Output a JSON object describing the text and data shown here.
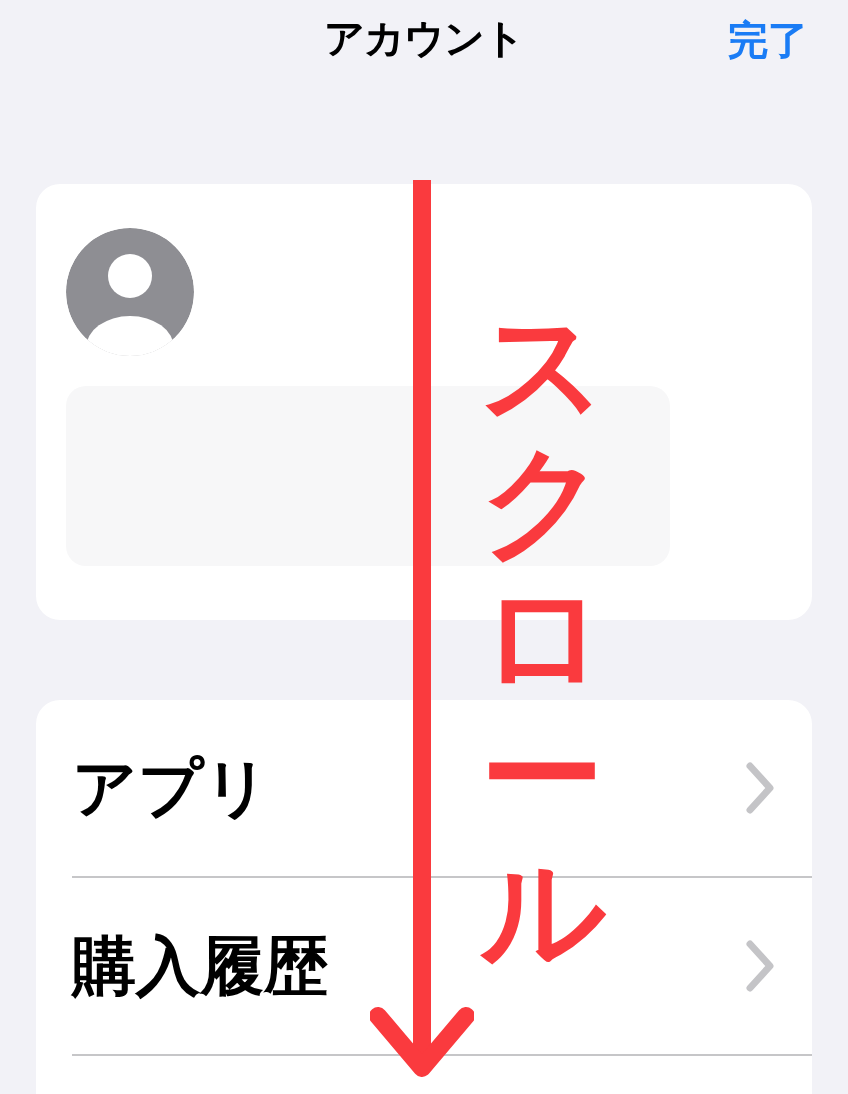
{
  "header": {
    "title": "アカウント",
    "done": "完了"
  },
  "menu": [
    {
      "label": "アプリ"
    },
    {
      "label": "購入履歴"
    }
  ],
  "annotation": {
    "text": "スクロール"
  }
}
